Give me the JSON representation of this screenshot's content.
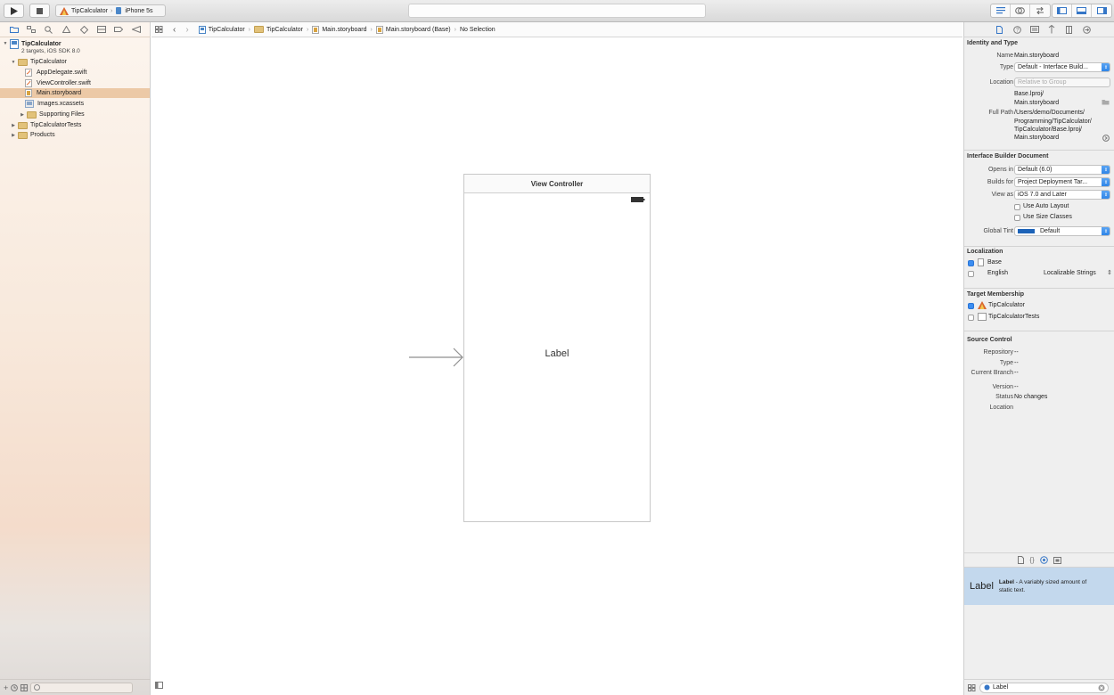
{
  "toolbar": {
    "scheme_name": "TipCalculator",
    "device_name": "iPhone 5s"
  },
  "navigator": {
    "project_name": "TipCalculator",
    "project_sub": "2 targets, iOS SDK 8.0",
    "group_name": "TipCalculator",
    "files": [
      "AppDelegate.swift",
      "ViewController.swift",
      "Main.storyboard",
      "Images.xcassets"
    ],
    "supporting_files": "Supporting Files",
    "tests_group": "TipCalculatorTests",
    "products_group": "Products",
    "selected_file": "Main.storyboard"
  },
  "jumpbar": {
    "crumbs": [
      "TipCalculator",
      "TipCalculator",
      "Main.storyboard",
      "Main.storyboard (Base)",
      "No Selection"
    ]
  },
  "canvas": {
    "scene_title": "View Controller",
    "label_text": "Label"
  },
  "inspector": {
    "identity": {
      "header": "Identity and Type",
      "name_label": "Name",
      "name_value": "Main.storyboard",
      "type_label": "Type",
      "type_value": "Default - Interface Build...",
      "location_label": "Location",
      "location_value": "Relative to Group",
      "location_path_1": "Base.lproj/",
      "location_path_2": "Main.storyboard",
      "full_path_label": "Full Path",
      "full_path_1": "/Users/demo/Documents/",
      "full_path_2": "Programming/TipCalculator/",
      "full_path_3": "TipCalculator/Base.lproj/",
      "full_path_4": "Main.storyboard"
    },
    "ib_doc": {
      "header": "Interface Builder Document",
      "opens_in_label": "Opens in",
      "opens_in_value": "Default (6.0)",
      "builds_for_label": "Builds for",
      "builds_for_value": "Project Deployment Tar...",
      "view_as_label": "View as",
      "view_as_value": "iOS 7.0 and Later",
      "auto_layout": "Use Auto Layout",
      "size_classes": "Use Size Classes",
      "global_tint_label": "Global Tint",
      "global_tint_value": "Default",
      "tint_color": "#1d63b8"
    },
    "localization": {
      "header": "Localization",
      "base": "Base",
      "english": "English",
      "english_value": "Localizable Strings"
    },
    "target": {
      "header": "Target Membership",
      "t1": "TipCalculator",
      "t2": "TipCalculatorTests"
    },
    "source_control": {
      "header": "Source Control",
      "repository_label": "Repository",
      "repository_value": "--",
      "type_label": "Type",
      "type_value": "--",
      "branch_label": "Current Branch",
      "branch_value": "--",
      "version_label": "Version",
      "version_value": "--",
      "status_label": "Status",
      "status_value": "No changes",
      "location_label": "Location"
    },
    "library": {
      "item_icon_text": "Label",
      "item_title": "Label",
      "item_desc_1": " - A variably sized amount of",
      "item_desc_2": "static text.",
      "filter_value": "Label"
    }
  }
}
